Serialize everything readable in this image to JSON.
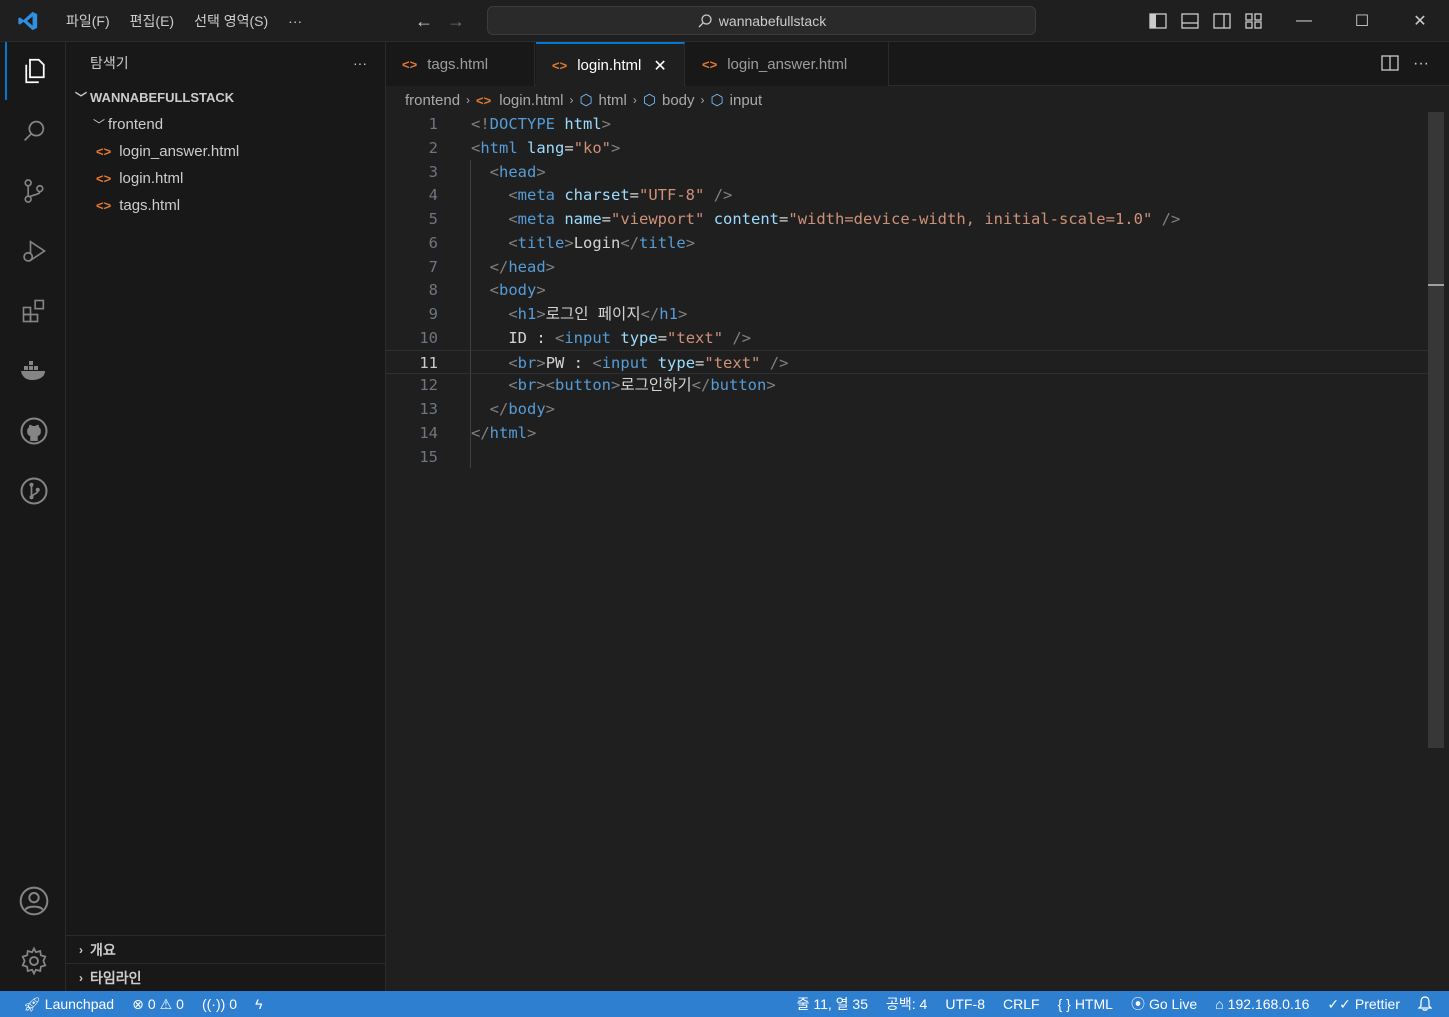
{
  "menu": [
    "파일(F)",
    "편집(E)",
    "선택 영역(S)",
    "···"
  ],
  "command_center": {
    "text": "wannabefullstack"
  },
  "sidebar": {
    "title": "탐색기",
    "more": "···",
    "root": "WANNABEFULLSTACK",
    "folder": "frontend",
    "files": [
      "login_answer.html",
      "login.html",
      "tags.html"
    ],
    "sections": [
      "개요",
      "타임라인"
    ]
  },
  "tabs": [
    {
      "label": "tags.html",
      "active": false
    },
    {
      "label": "login.html",
      "active": true
    },
    {
      "label": "login_answer.html",
      "active": false
    }
  ],
  "breadcrumb": [
    "frontend",
    "login.html",
    "html",
    "body",
    "input"
  ],
  "code": {
    "line_numbers": [
      "1",
      "2",
      "3",
      "4",
      "5",
      "6",
      "7",
      "8",
      "9",
      "10",
      "11",
      "12",
      "13",
      "14",
      "15"
    ],
    "current_line": 11
  },
  "status": {
    "launchpad": "Launchpad",
    "errors": "0",
    "warnings": "0",
    "ports": "0",
    "position": "줄 11, 열 35",
    "spaces": "공백: 4",
    "encoding": "UTF-8",
    "eol": "CRLF",
    "language": "HTML",
    "golive": "Go Live",
    "ip": "192.168.0.16",
    "prettier": "Prettier"
  },
  "colors": {
    "accent": "#0078d4",
    "statusbar": "#2f7fd1",
    "html_icon": "#e37933"
  }
}
